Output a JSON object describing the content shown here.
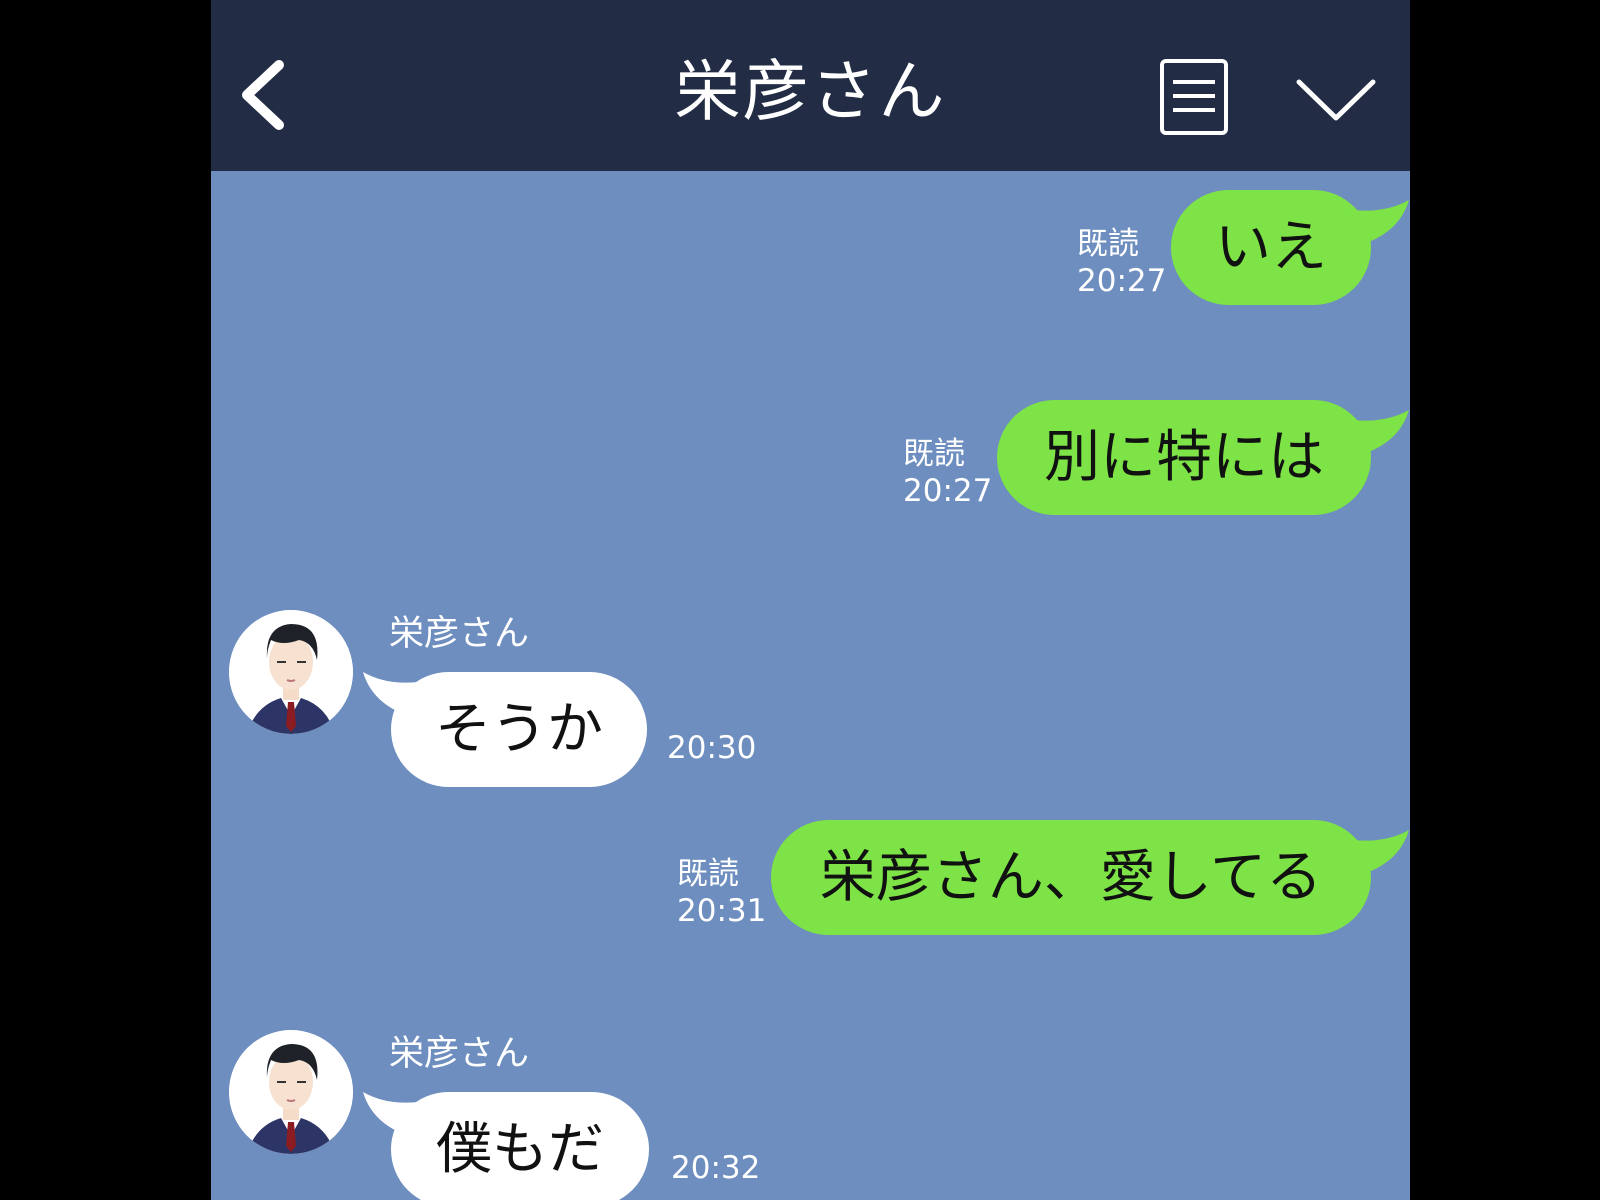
{
  "header": {
    "title": "栄彦さん"
  },
  "messages": [
    {
      "side": "right",
      "text": "いえ",
      "read": "既読",
      "time": "20:27"
    },
    {
      "side": "right",
      "text": "別に特には",
      "read": "既読",
      "time": "20:27"
    },
    {
      "side": "left",
      "sender": "栄彦さん",
      "text": "そうか",
      "time": "20:30"
    },
    {
      "side": "right",
      "text": "栄彦さん、愛してる",
      "read": "既読",
      "time": "20:31"
    },
    {
      "side": "left",
      "sender": "栄彦さん",
      "text": "僕もだ",
      "time": "20:32"
    }
  ],
  "colors": {
    "background": "#6d8ebf",
    "header": "#222c45",
    "sent_bubble": "#7de346",
    "received_bubble": "#ffffff"
  },
  "icons": {
    "back": "chevron-left-icon",
    "menu": "menu-list-icon",
    "dropdown": "chevron-down-icon"
  }
}
